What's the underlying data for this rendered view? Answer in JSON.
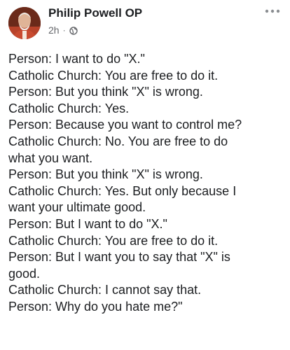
{
  "post": {
    "author": "Philip Powell OP",
    "time": "2h",
    "separator": "·",
    "more_icon": "more-horizontal-icon",
    "privacy_icon": "globe-icon",
    "lines": [
      "Person: I want to do \"X.\"",
      "Catholic Church: You are free to do it.",
      "Person: But you think \"X\" is wrong.",
      "Catholic Church: Yes.",
      "Person: Because you want to control me?",
      "Catholic Church: No. You are free to do",
      "what you want.",
      "Person: But you think \"X\" is wrong.",
      "Catholic Church: Yes. But only because I",
      "want your ultimate good.",
      "Person: But I want to do \"X.\"",
      "Catholic Church: You are free to do it.",
      "Person: But I want you to say that \"X\" is",
      "good.",
      "Catholic Church: I cannot say that.",
      "Person: Why do you hate me?\""
    ]
  }
}
